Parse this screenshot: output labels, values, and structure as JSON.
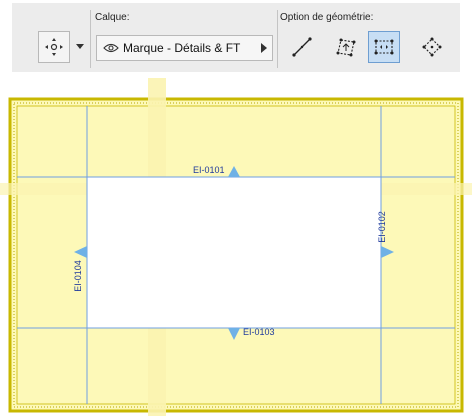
{
  "toolbar": {
    "pick_tool": {
      "icon": "move-target-icon"
    },
    "layer": {
      "caption": "Calque:",
      "value": "Marque - Détails & FT",
      "icon": "eye-icon"
    },
    "geometry": {
      "caption": "Option de géométrie:",
      "options": [
        {
          "icon": "line-geometry-icon",
          "selected": false
        },
        {
          "icon": "polygon-geometry-icon",
          "selected": false
        },
        {
          "icon": "rectangle-geometry-icon",
          "selected": true
        },
        {
          "icon": "rotated-rectangle-geometry-icon",
          "selected": false
        }
      ]
    }
  },
  "drawing": {
    "markers": [
      {
        "id": "EI-0101",
        "direction": "up"
      },
      {
        "id": "EI-0102",
        "direction": "right"
      },
      {
        "id": "EI-0103",
        "direction": "down"
      },
      {
        "id": "EI-0104",
        "direction": "left"
      }
    ],
    "colors": {
      "zone_fill": "#fdf9b8",
      "zone_border": "#c8b800",
      "guide_line": "#6f9fe2",
      "marker": "#6fb1e6",
      "label": "#1f3a9c"
    }
  }
}
